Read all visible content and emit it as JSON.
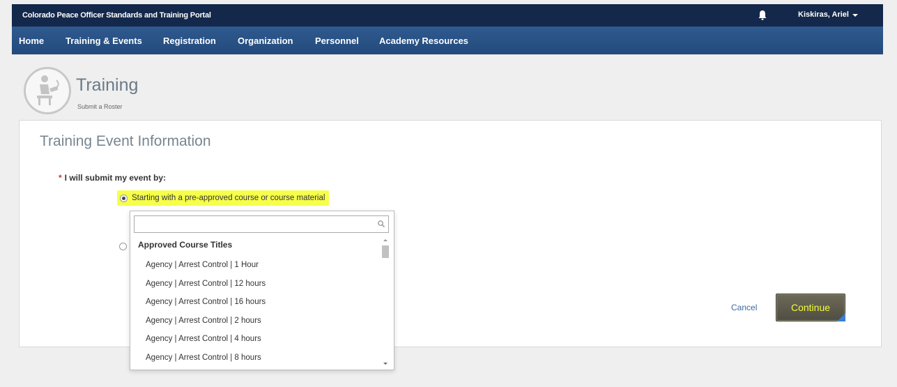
{
  "topbar": {
    "portal_title": "Colorado Peace Officer Standards and Training Portal",
    "user_name": "Kiskiras, Ariel"
  },
  "nav": {
    "items": [
      "Home",
      "Training & Events",
      "Registration",
      "Organization",
      "Personnel",
      "Academy Resources"
    ]
  },
  "page": {
    "title": "Training",
    "subtitle": "Submit a Roster"
  },
  "form": {
    "section_title": "Training Event Information",
    "required_marker": "*",
    "question": "I will submit my event by:",
    "option1_label": "Starting with a pre-approved course or course material",
    "option1_selected": true,
    "option2_selected": false,
    "cancel_label": "Cancel",
    "continue_label": "Continue"
  },
  "dropdown": {
    "search_value": "",
    "group_label": "Approved Course Titles",
    "items": [
      "Agency | Arrest Control | 1 Hour",
      "Agency | Arrest Control | 12 hours",
      "Agency | Arrest Control | 16 hours",
      "Agency | Arrest Control | 2 hours",
      "Agency | Arrest Control | 4 hours",
      "Agency | Arrest Control | 8 hours"
    ]
  },
  "colors": {
    "topbar": "#13284a",
    "navbar": "#2a5286",
    "highlight": "#f6ff4a",
    "continue_text": "#f4ff3a"
  },
  "icons": {
    "bell": "bell-icon",
    "search": "search-icon",
    "logo": "trainee-at-desk-logo"
  }
}
